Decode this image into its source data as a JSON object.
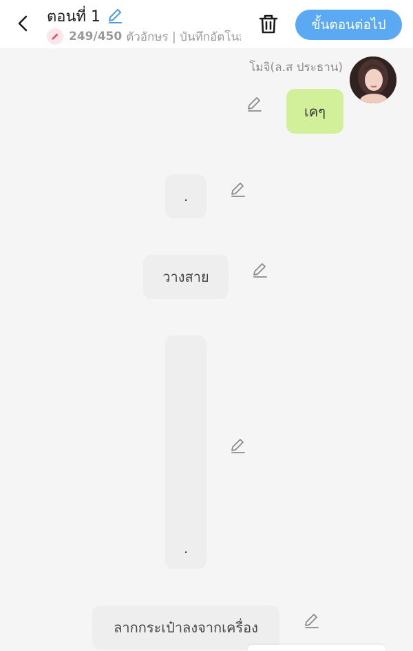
{
  "header": {
    "title": "ตอนที่ 1",
    "char_count": "249/450",
    "status_text": "ตัวอักษร | บันทึกอัตโนมัติ",
    "next_label": "ขั้นตอนต่อไป"
  },
  "chat": {
    "speaker_name": "โมจิ(ล.ส ประธาน)",
    "messages": [
      {
        "text": "เคๆ",
        "side": "right"
      },
      {
        "text": ".",
        "side": "center"
      },
      {
        "text": "วางสาย",
        "side": "center"
      },
      {
        "text": ".",
        "side": "center"
      },
      {
        "text": "ลากกระเป๋าลงจากเครื่อง",
        "side": "center"
      }
    ]
  },
  "colors": {
    "accent": "#5aa9f2",
    "my_bubble": "#d2f09a",
    "narration_bubble": "#eeeeee",
    "background": "#f5f5f5"
  },
  "icons": {
    "back": "chevron-left-icon",
    "title_edit": "pencil-icon",
    "counter": "pencil-icon",
    "delete": "trash-icon",
    "message_edit": "pencil-icon"
  }
}
